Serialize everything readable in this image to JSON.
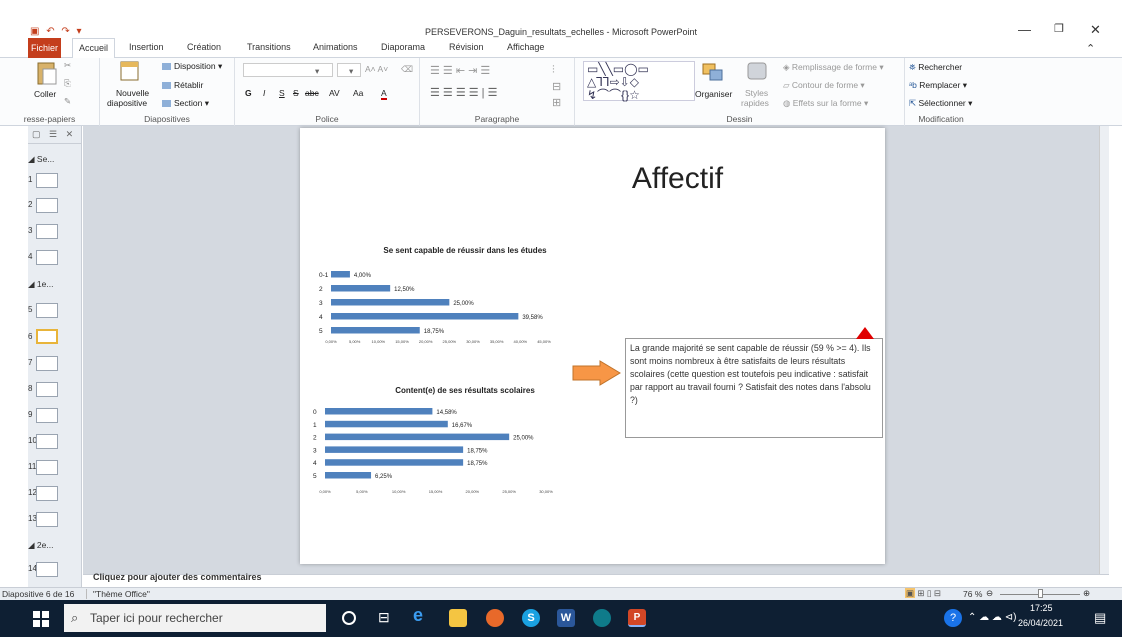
{
  "window": {
    "title": "PERSEVERONS_Daguin_resultats_echelles - Microsoft PowerPoint"
  },
  "tabs": [
    "Fichier",
    "Accueil",
    "Insertion",
    "Création",
    "Transitions",
    "Animations",
    "Diaporama",
    "Révision",
    "Affichage"
  ],
  "ribbon": {
    "presse_papiers": {
      "label": "resse-papiers",
      "coller": "Coller"
    },
    "diapositives": {
      "label": "Diapositives",
      "nouvelle": "Nouvelle",
      "diapositive": "diapositive",
      "disposition": "Disposition",
      "retablir": "Rétablir",
      "section": "Section"
    },
    "police": {
      "label": "Police",
      "bold": "G",
      "italic": "I",
      "underline": "S",
      "strike": "S",
      "abc": "abc",
      "av": "AV",
      "aa": "Aa",
      "a": "A"
    },
    "paragraphe": {
      "label": "Paragraphe"
    },
    "dessin": {
      "label": "Dessin",
      "organiser": "Organiser",
      "styles": "Styles",
      "rapides": "rapides",
      "remplissage": "Remplissage de forme",
      "contour": "Contour de forme",
      "effets": "Effets sur la forme"
    },
    "modification": {
      "label": "Modification",
      "rechercher": "Rechercher",
      "remplacer": "Remplacer",
      "selectionner": "Sélectionner"
    }
  },
  "left_pane": {
    "sections": [
      "Se...",
      "1e...",
      "2e..."
    ],
    "slide_numbers": [
      "1",
      "2",
      "3",
      "4",
      "5",
      "6",
      "7",
      "8",
      "9",
      "10",
      "11",
      "12",
      "13",
      "14"
    ],
    "selected": "6"
  },
  "slide": {
    "title": "Affectif",
    "textbox": "La grande majorité  se sent capable de réussir (59 % >= 4). Ils sont  moins nombreux  à être satisfaits de leurs résultats scolaires (cette question  est toutefois peu indicative : satisfait par rapport au travail fourni ? Satisfait des notes dans l'absolu ?)"
  },
  "chart_data": [
    {
      "type": "bar",
      "title": "Se sent capable de réussir dans les études",
      "categories": [
        "0-1",
        "2",
        "3",
        "4",
        "5"
      ],
      "values": [
        4.0,
        12.5,
        25.0,
        39.58,
        18.75
      ],
      "value_labels": [
        "4,00%",
        "12,50%",
        "25,00%",
        "39,58%",
        "18,75%"
      ],
      "xticks": [
        "0,00%",
        "5,00%",
        "10,00%",
        "15,00%",
        "20,00%",
        "25,00%",
        "30,00%",
        "35,00%",
        "40,00%",
        "45,00%"
      ],
      "xlim": [
        0,
        45
      ],
      "color": "#4f81bd"
    },
    {
      "type": "bar",
      "title": "Content(e)  de ses résultats scolaires",
      "categories": [
        "0",
        "1",
        "2",
        "3",
        "4",
        "5"
      ],
      "values": [
        14.58,
        16.67,
        25.0,
        18.75,
        18.75,
        6.25
      ],
      "value_labels": [
        "14,58%",
        "16,67%",
        "25,00%",
        "18,75%",
        "18,75%",
        "6,25%"
      ],
      "xticks": [
        "0,00%",
        "5,00%",
        "10,00%",
        "15,00%",
        "20,00%",
        "25,00%",
        "30,00%"
      ],
      "xlim": [
        0,
        30
      ],
      "color": "#4f81bd"
    }
  ],
  "notes": {
    "text": "Cliquez pour ajouter des commentaires"
  },
  "statusbar": {
    "slide_info": "Diapositive 6 de 16",
    "theme": "\"Thème Office\"",
    "zoom": "76 %"
  },
  "taskbar": {
    "search_placeholder": "Taper ici pour rechercher",
    "time": "17:25",
    "date": "26/04/2021"
  }
}
